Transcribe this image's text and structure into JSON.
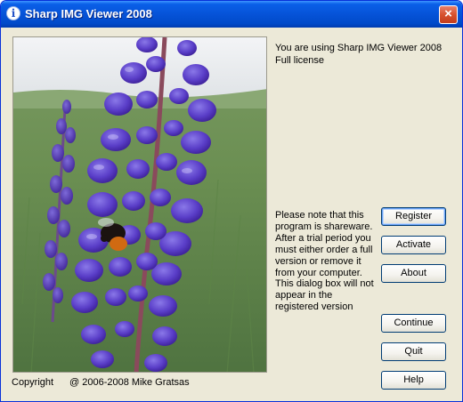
{
  "window": {
    "title": "Sharp IMG Viewer 2008",
    "close_glyph": "×"
  },
  "icons": {
    "title": "info-icon",
    "close": "close-icon"
  },
  "main": {
    "license_text": "You are using Sharp IMG Viewer 2008 Full license",
    "note_text": "Please note that this program is shareware. After a trial period you must either order a full version or remove it from your computer. This dialog box will not appear in the registered version"
  },
  "buttons": {
    "register": "Register",
    "activate": "Activate",
    "about": "About",
    "continue": "Continue",
    "quit": "Quit",
    "help": "Help"
  },
  "footer": {
    "copyright_label": "Copyright",
    "copyright_text": "@ 2006-2008 Mike Gratsas"
  },
  "colors": {
    "titlebar": "#0653d8",
    "dialog_bg": "#ece9d8",
    "close": "#d6512d",
    "flower": "#5c3fc4"
  }
}
